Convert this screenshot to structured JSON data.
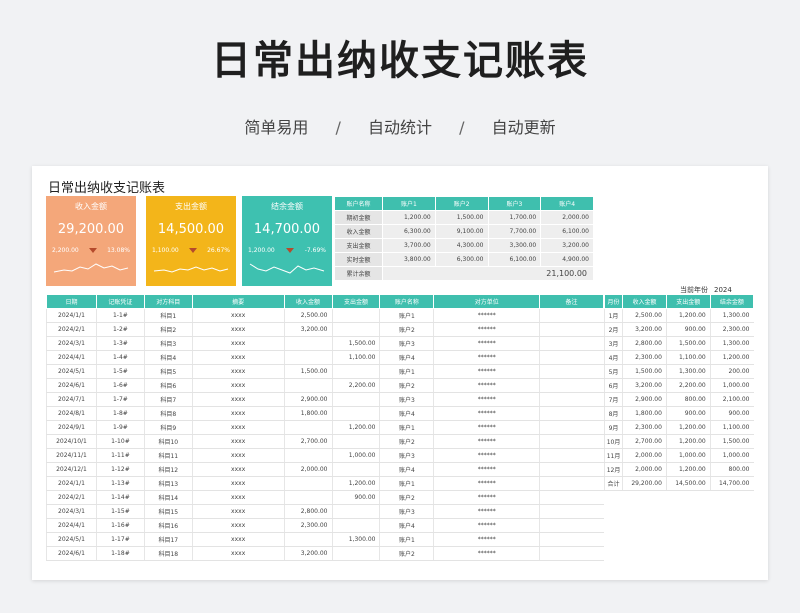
{
  "hero": {
    "title": "日常出纳收支记账表",
    "subtitle": [
      "简单易用",
      "自动统计",
      "自动更新"
    ],
    "separator": "/"
  },
  "sheet": {
    "title": "日常出纳收支记账表",
    "cards": [
      {
        "label": "收入金额",
        "value": "29,200.00",
        "prev": "2,200.00",
        "change": "13.08%",
        "color": "#f4a77a"
      },
      {
        "label": "支出金额",
        "value": "14,500.00",
        "prev": "1,100.00",
        "change": "26.67%",
        "color": "#f3b51a"
      },
      {
        "label": "结余金额",
        "value": "14,700.00",
        "prev": "1,200.00",
        "change": "-7.69%",
        "color": "#3ec1b0"
      }
    ],
    "accounts": {
      "headers": [
        "账户名称",
        "账户1",
        "账户2",
        "账户3",
        "账户4"
      ],
      "rows": [
        {
          "label": "期初金额",
          "values": [
            "1,200.00",
            "1,500.00",
            "1,700.00",
            "2,000.00"
          ]
        },
        {
          "label": "收入金额",
          "values": [
            "6,300.00",
            "9,100.00",
            "7,700.00",
            "6,100.00"
          ]
        },
        {
          "label": "支出金额",
          "values": [
            "3,700.00",
            "4,300.00",
            "3,300.00",
            "3,200.00"
          ]
        },
        {
          "label": "实时金额",
          "values": [
            "3,800.00",
            "6,300.00",
            "6,100.00",
            "4,900.00"
          ]
        }
      ],
      "total_label": "累计余额",
      "total_value": "21,100.00"
    },
    "ledger": {
      "headers": [
        "日期",
        "记账凭证",
        "对方科目",
        "摘要",
        "收入金额",
        "支出金额",
        "账户名称",
        "对方单位",
        "备注"
      ],
      "rows": [
        [
          "2024/1/1",
          "1-1#",
          "科目1",
          "xxxx",
          "2,500.00",
          "",
          "账户1",
          "******",
          ""
        ],
        [
          "2024/2/1",
          "1-2#",
          "科目2",
          "xxxx",
          "3,200.00",
          "",
          "账户2",
          "******",
          ""
        ],
        [
          "2024/3/1",
          "1-3#",
          "科目3",
          "xxxx",
          "",
          "1,500.00",
          "账户3",
          "******",
          ""
        ],
        [
          "2024/4/1",
          "1-4#",
          "科目4",
          "xxxx",
          "",
          "1,100.00",
          "账户4",
          "******",
          ""
        ],
        [
          "2024/5/1",
          "1-5#",
          "科目5",
          "xxxx",
          "1,500.00",
          "",
          "账户1",
          "******",
          ""
        ],
        [
          "2024/6/1",
          "1-6#",
          "科目6",
          "xxxx",
          "",
          "2,200.00",
          "账户2",
          "******",
          ""
        ],
        [
          "2024/7/1",
          "1-7#",
          "科目7",
          "xxxx",
          "2,900.00",
          "",
          "账户3",
          "******",
          ""
        ],
        [
          "2024/8/1",
          "1-8#",
          "科目8",
          "xxxx",
          "1,800.00",
          "",
          "账户4",
          "******",
          ""
        ],
        [
          "2024/9/1",
          "1-9#",
          "科目9",
          "xxxx",
          "",
          "1,200.00",
          "账户1",
          "******",
          ""
        ],
        [
          "2024/10/1",
          "1-10#",
          "科目10",
          "xxxx",
          "2,700.00",
          "",
          "账户2",
          "******",
          ""
        ],
        [
          "2024/11/1",
          "1-11#",
          "科目11",
          "xxxx",
          "",
          "1,000.00",
          "账户3",
          "******",
          ""
        ],
        [
          "2024/12/1",
          "1-12#",
          "科目12",
          "xxxx",
          "2,000.00",
          "",
          "账户4",
          "******",
          ""
        ],
        [
          "2024/1/1",
          "1-13#",
          "科目13",
          "xxxx",
          "",
          "1,200.00",
          "账户1",
          "******",
          ""
        ],
        [
          "2024/2/1",
          "1-14#",
          "科目14",
          "xxxx",
          "",
          "900.00",
          "账户2",
          "******",
          ""
        ],
        [
          "2024/3/1",
          "1-15#",
          "科目15",
          "xxxx",
          "2,800.00",
          "",
          "账户3",
          "******",
          ""
        ],
        [
          "2024/4/1",
          "1-16#",
          "科目16",
          "xxxx",
          "2,300.00",
          "",
          "账户4",
          "******",
          ""
        ],
        [
          "2024/5/1",
          "1-17#",
          "科目17",
          "xxxx",
          "",
          "1,300.00",
          "账户1",
          "******",
          ""
        ],
        [
          "2024/6/1",
          "1-18#",
          "科目18",
          "xxxx",
          "3,200.00",
          "",
          "账户2",
          "******",
          ""
        ]
      ]
    },
    "monthly": {
      "year_label": "当前年份",
      "year": "2024",
      "headers": [
        "月份",
        "收入金额",
        "支出金额",
        "结余金额"
      ],
      "rows": [
        [
          "1月",
          "2,500.00",
          "1,200.00",
          "1,300.00"
        ],
        [
          "2月",
          "3,200.00",
          "900.00",
          "2,300.00"
        ],
        [
          "3月",
          "2,800.00",
          "1,500.00",
          "1,300.00"
        ],
        [
          "4月",
          "2,300.00",
          "1,100.00",
          "1,200.00"
        ],
        [
          "5月",
          "1,500.00",
          "1,300.00",
          "200.00"
        ],
        [
          "6月",
          "3,200.00",
          "2,200.00",
          "1,000.00"
        ],
        [
          "7月",
          "2,900.00",
          "800.00",
          "2,100.00"
        ],
        [
          "8月",
          "1,800.00",
          "900.00",
          "900.00"
        ],
        [
          "9月",
          "2,300.00",
          "1,200.00",
          "1,100.00"
        ],
        [
          "10月",
          "2,700.00",
          "1,200.00",
          "1,500.00"
        ],
        [
          "11月",
          "2,000.00",
          "1,000.00",
          "1,000.00"
        ],
        [
          "12月",
          "2,000.00",
          "1,200.00",
          "800.00"
        ],
        [
          "合计",
          "29,200.00",
          "14,500.00",
          "14,700.00"
        ]
      ]
    }
  }
}
